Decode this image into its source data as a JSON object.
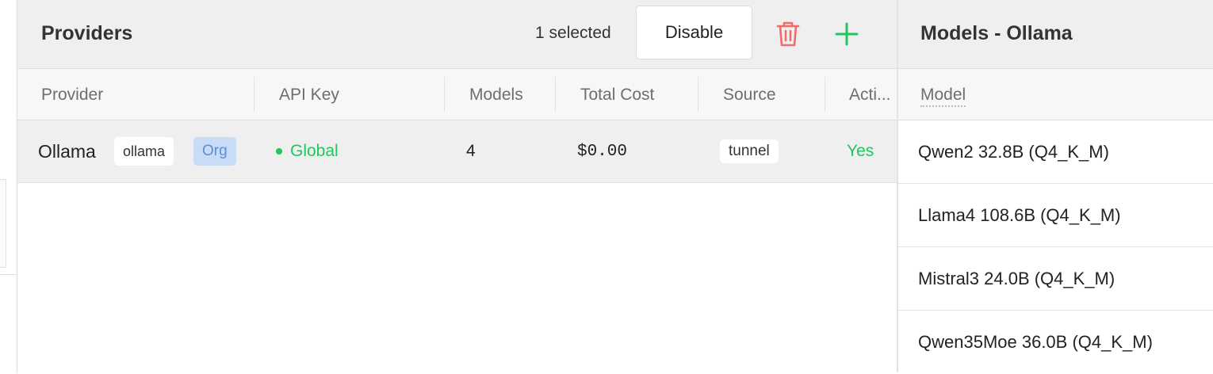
{
  "providers_panel": {
    "title": "Providers",
    "selected_text": "1 selected",
    "disable_label": "Disable",
    "columns": [
      "Provider",
      "API Key",
      "Models",
      "Total Cost",
      "Source",
      "Acti..."
    ],
    "rows": [
      {
        "provider": "Ollama",
        "provider_tag": "ollama",
        "org_badge": "Org",
        "api_key": "Global",
        "models": "4",
        "total_cost": "$0.00",
        "source": "tunnel",
        "active": "Yes"
      }
    ]
  },
  "models_panel": {
    "title": "Models - Ollama",
    "column": "Model",
    "models": [
      "Qwen2 32.8B (Q4_K_M)",
      "Llama4 108.6B (Q4_K_M)",
      "Mistral3 24.0B (Q4_K_M)",
      "Qwen35Moe 36.0B (Q4_K_M)"
    ]
  },
  "colors": {
    "accent_green": "#23c55e",
    "delete_red": "#f06b6b",
    "org_badge_bg": "#c9dcf6"
  },
  "icons": [
    "trash-icon",
    "plus-icon",
    "status-dot-icon"
  ]
}
